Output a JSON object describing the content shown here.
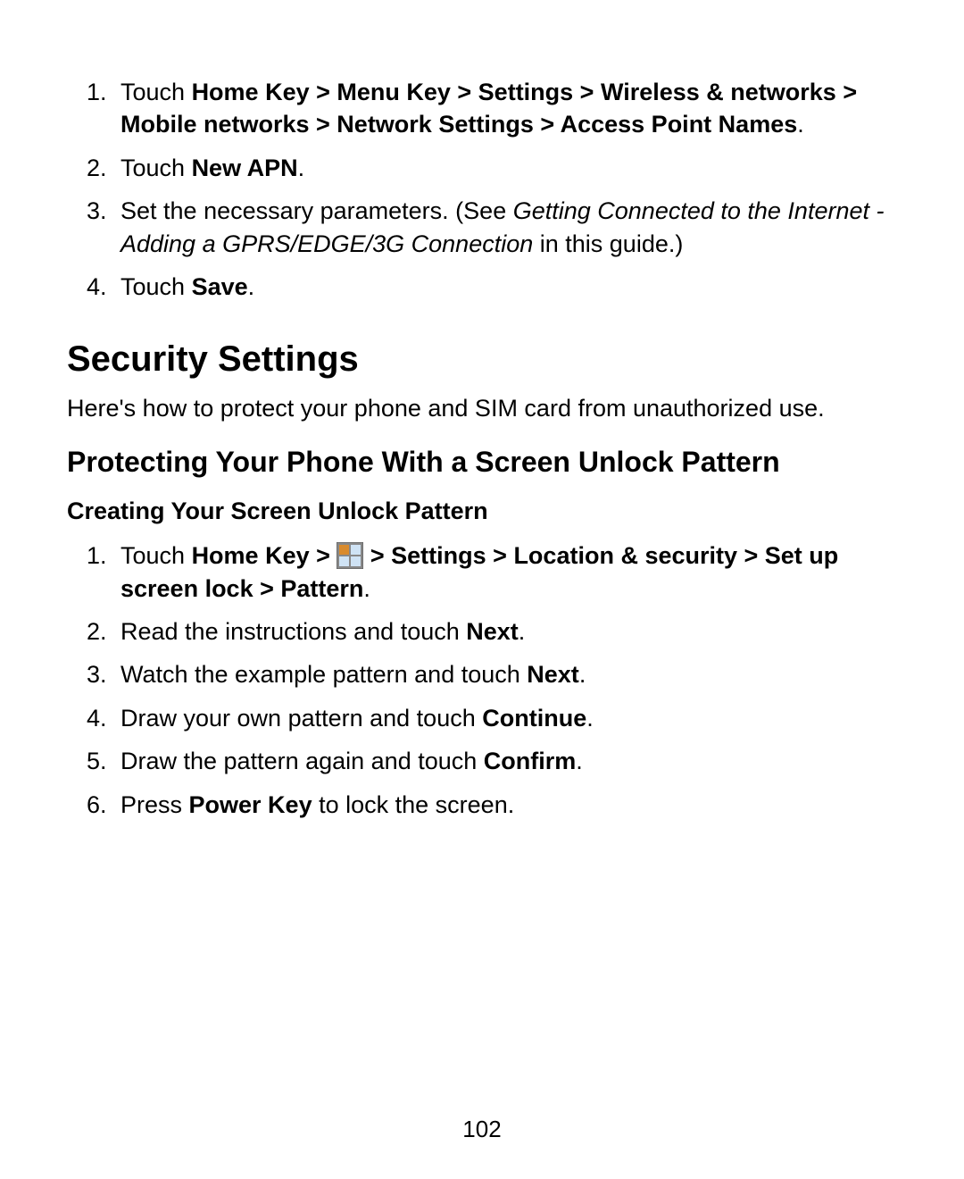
{
  "list1": {
    "item1": {
      "pre": "Touch ",
      "bold": "Home Key > Menu Key > Settings > Wireless & networks > Mobile networks > Network Settings > Access Point Names",
      "post": "."
    },
    "item2": {
      "pre": "Touch ",
      "bold": "New APN",
      "post": "."
    },
    "item3": {
      "pre": "Set the necessary parameters. (See ",
      "italic": "Getting Connected to the Internet - Adding a GPRS/EDGE/3G Connection",
      "post": " in this guide.)"
    },
    "item4": {
      "pre": "Touch ",
      "bold": "Save",
      "post": "."
    }
  },
  "heading1": "Security Settings",
  "intro": "Here's how to protect your phone and SIM card from unauthorized use.",
  "heading2": "Protecting Your Phone With a Screen Unlock Pattern",
  "heading3": "Creating Your Screen Unlock Pattern",
  "list2": {
    "item1": {
      "pre": "Touch ",
      "bold_before_icon": "Home Key > ",
      "bold_after_icon": " > Settings > Location & security > Set up screen lock > Pattern",
      "post": "."
    },
    "item2": {
      "pre": "Read the instructions and touch ",
      "bold": "Next",
      "post": "."
    },
    "item3": {
      "pre": "Watch the example pattern and touch ",
      "bold": "Next",
      "post": "."
    },
    "item4": {
      "pre": "Draw your own pattern and touch ",
      "bold": "Continue",
      "post": "."
    },
    "item5": {
      "pre": "Draw the pattern again and touch ",
      "bold": "Confirm",
      "post": "."
    },
    "item6": {
      "pre": "Press ",
      "bold": "Power Key",
      "post": " to lock the screen."
    }
  },
  "page_number": "102"
}
